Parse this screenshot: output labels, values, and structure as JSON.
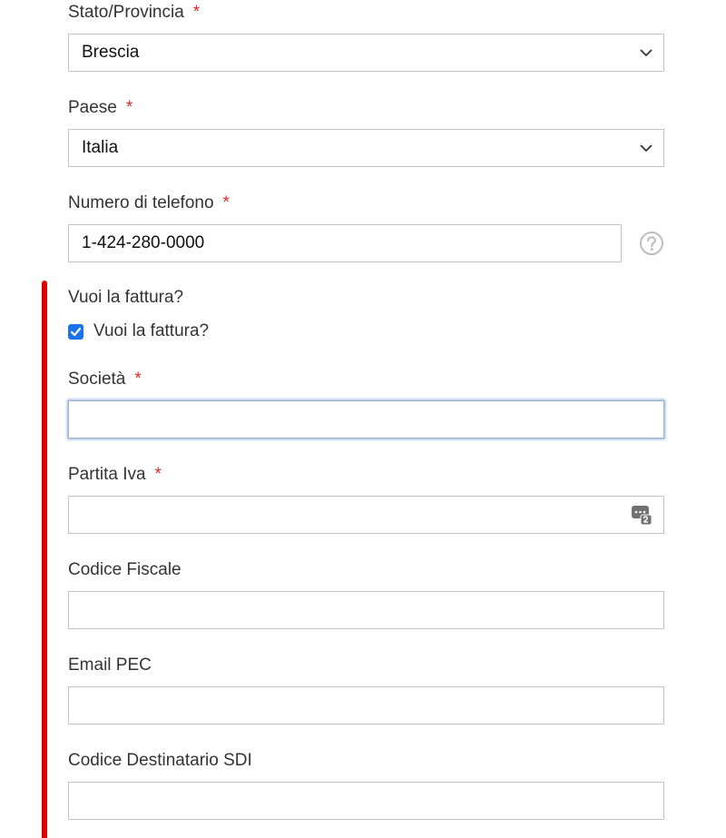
{
  "form": {
    "state": {
      "label": "Stato/Provincia",
      "required_mark": "*",
      "value": "Brescia"
    },
    "country": {
      "label": "Paese",
      "required_mark": "*",
      "value": "Italia"
    },
    "phone": {
      "label": "Numero di telefono",
      "required_mark": "*",
      "value": "1-424-280-0000"
    },
    "invoice": {
      "question": "Vuoi la fattura?",
      "checkbox_label": "Vuoi la fattura?",
      "checked": true
    },
    "company": {
      "label": "Società",
      "required_mark": "*",
      "value": ""
    },
    "vat": {
      "label": "Partita Iva",
      "required_mark": "*",
      "value": ""
    },
    "fiscal_code": {
      "label": "Codice Fiscale",
      "value": ""
    },
    "pec_email": {
      "label": "Email PEC",
      "value": ""
    },
    "sdi_code": {
      "label": "Codice Destinatario SDI",
      "value": ""
    }
  },
  "icons": {
    "select_arrow": "chevron-down-icon",
    "help": "question-circle-icon",
    "password_manager": "password-manager-icon"
  },
  "colors": {
    "accent_bar": "#d90000",
    "required": "#e02b27",
    "checkbox": "#1a73e8",
    "border": "#c2c2c2",
    "focus": "#8db0d6"
  }
}
